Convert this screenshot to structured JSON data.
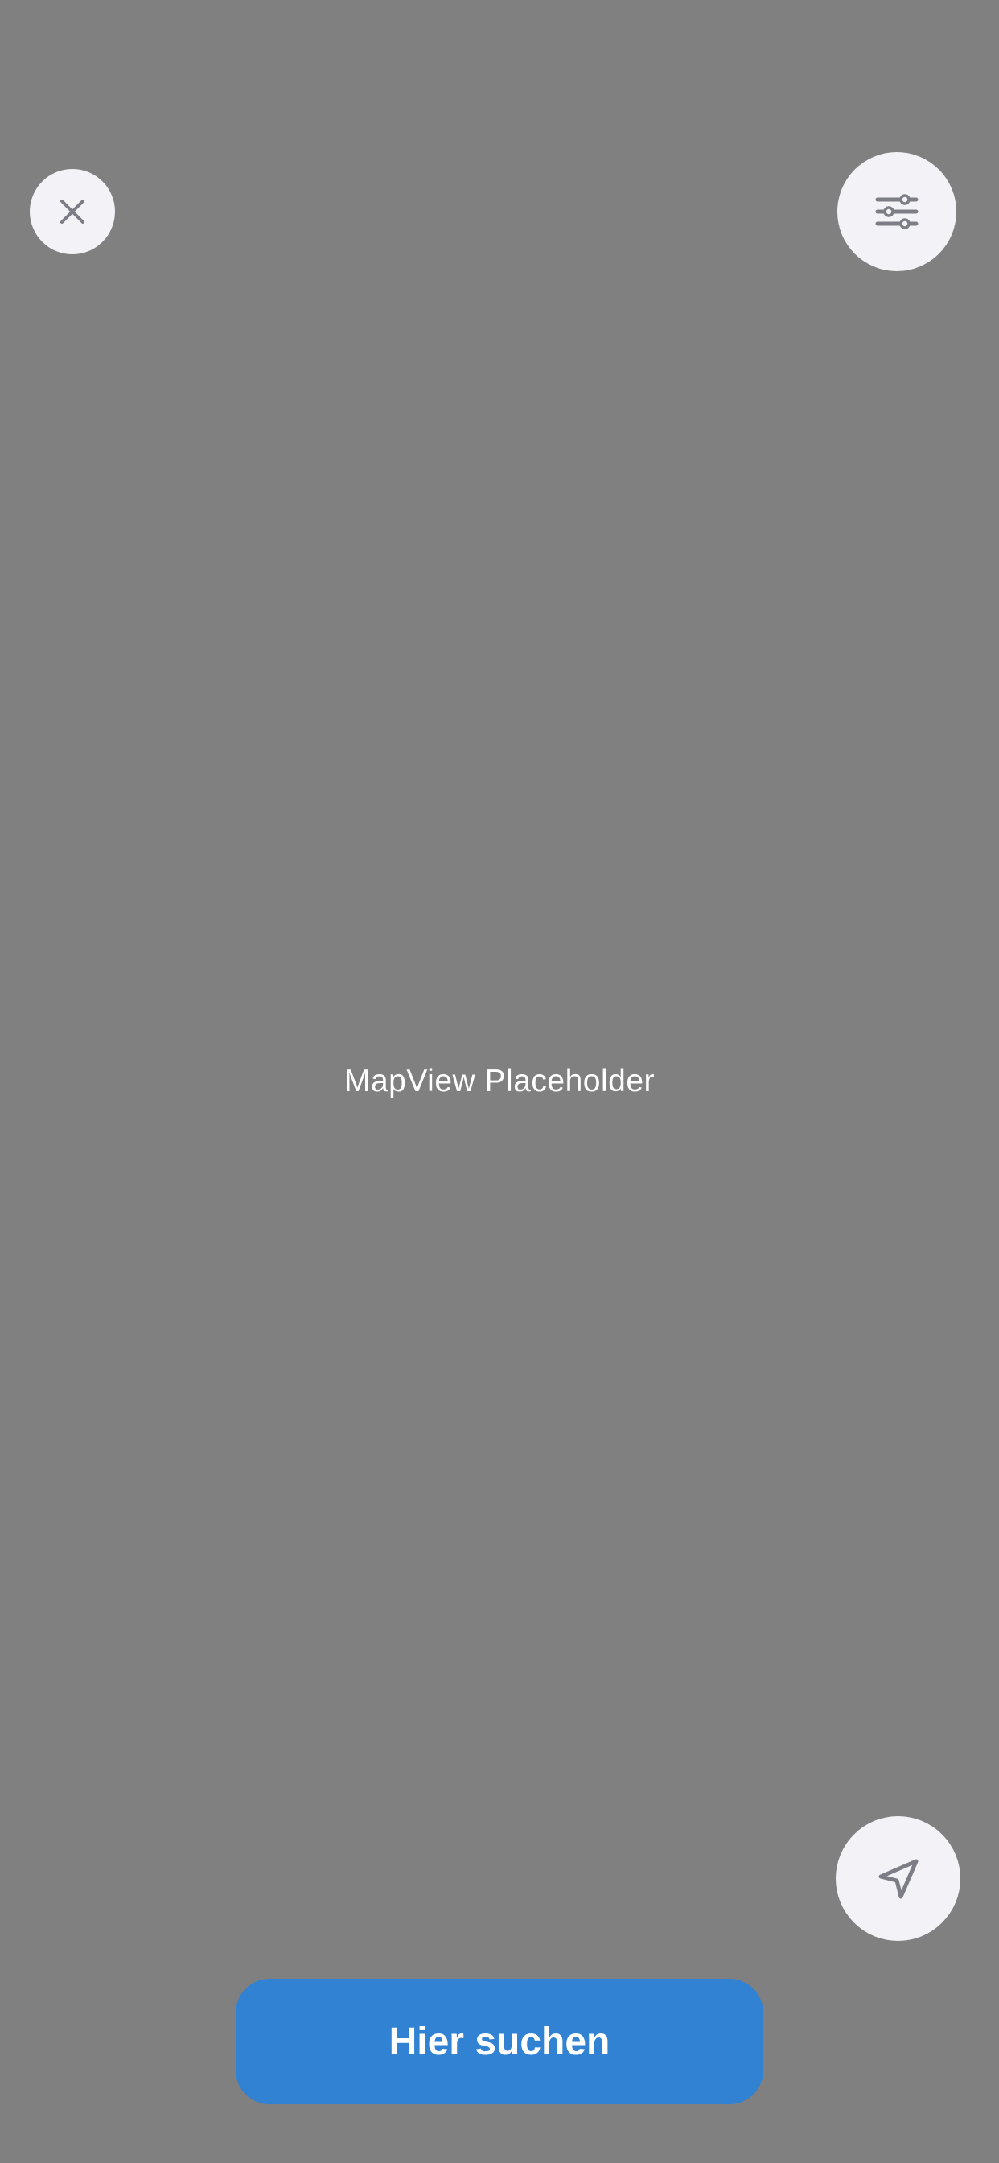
{
  "map": {
    "placeholder_text": "MapView Placeholder"
  },
  "controls": {
    "close_icon": "close-icon",
    "filter_icon": "sliders-icon",
    "locate_icon": "location-arrow-icon",
    "search_here_label": "Hier suchen"
  },
  "colors": {
    "map_background": "#808080",
    "control_background": "#f2f2f7",
    "icon_color": "#7d7d86",
    "primary_button": "#3182d3",
    "primary_button_text": "#ffffff"
  }
}
